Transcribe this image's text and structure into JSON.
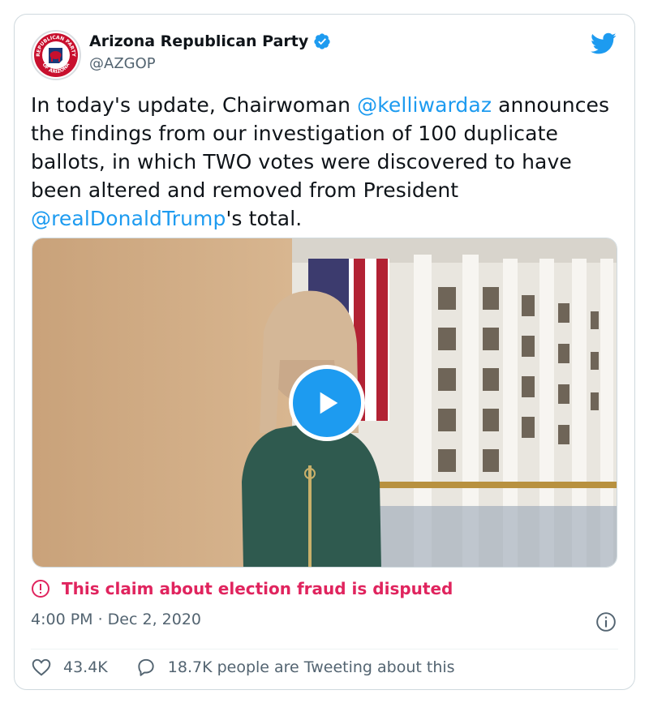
{
  "author": {
    "display_name": "Arizona Republican Party",
    "handle": "@AZGOP",
    "avatar_icon": "party-seal-icon",
    "avatar_text_top": "REPUBLICAN PARTY",
    "avatar_text_bottom": "OF ARIZONA",
    "verified": true
  },
  "tweet": {
    "text_1": "In today's update, Chairwoman ",
    "mention_1": "@kelliwardaz",
    "text_2": " announces the findings from our investigation of 100 duplicate ballots, in which TWO votes were discovered to have been altered and removed from President ",
    "mention_2": "@realDonaldTrump",
    "text_3": "'s total."
  },
  "media": {
    "type": "video",
    "play_icon": "play-icon"
  },
  "notice": {
    "icon": "alert-circle-icon",
    "text": "This claim about election fraud is disputed"
  },
  "timestamp": "4:00 PM · Dec 2, 2020",
  "stats": {
    "likes": "43.4K",
    "replies_text": "18.7K people are Tweeting about this"
  },
  "colors": {
    "link": "#1d9bf0",
    "warning": "#e0245e",
    "muted": "#536471",
    "border": "#cfd9de"
  }
}
